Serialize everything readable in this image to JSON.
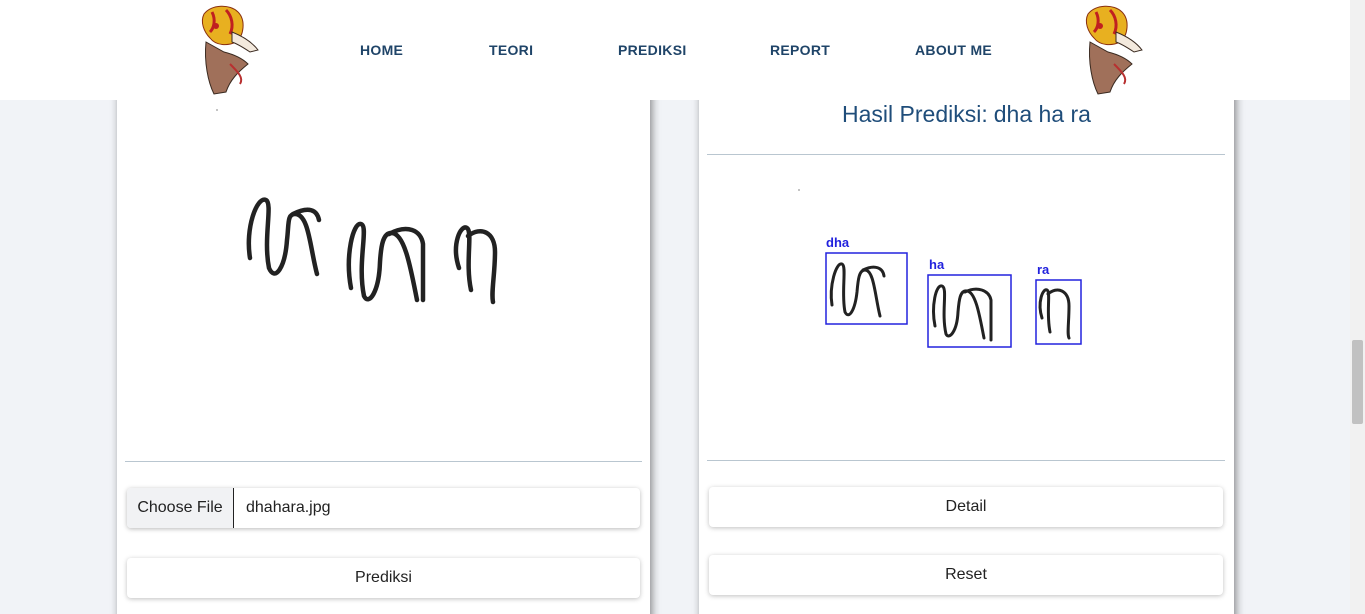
{
  "nav": {
    "items": [
      "HOME",
      "TEORI",
      "PREDIKSI",
      "REPORT",
      "ABOUT ME"
    ]
  },
  "upload": {
    "choose_file_label": "Choose File",
    "file_name": "dhahara.jpg",
    "predict_button": "Prediksi"
  },
  "result": {
    "title_prefix": "Hasil Prediksi:",
    "title_value": "dha ha ra",
    "detections": [
      {
        "label": "dha"
      },
      {
        "label": "ha"
      },
      {
        "label": "ra"
      }
    ],
    "detail_button": "Detail",
    "reset_button": "Reset"
  },
  "colors": {
    "nav_text": "#1f4468",
    "title_text": "#1f4d7a",
    "box_color": "#2222dd"
  }
}
